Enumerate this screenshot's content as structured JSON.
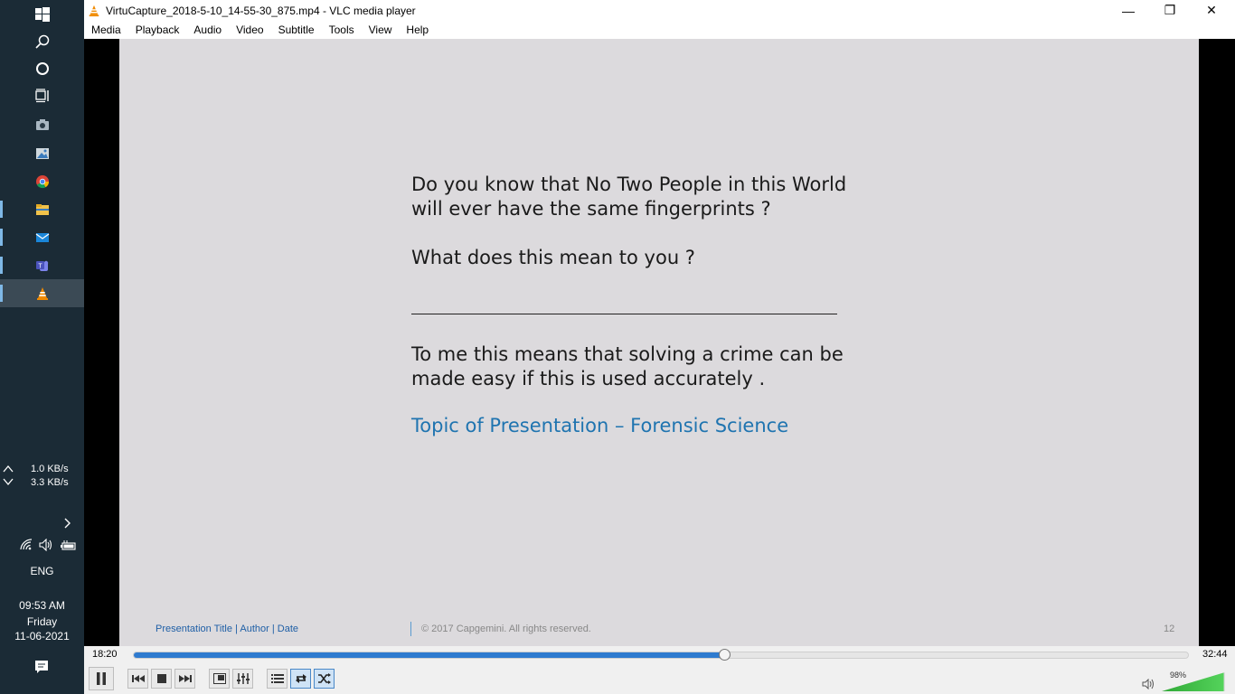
{
  "window": {
    "title": "VirtuCapture_2018-5-10_14-55-30_875.mp4 - VLC media player",
    "minimize": "—",
    "restore": "❐",
    "close": "✕"
  },
  "menu": [
    "Media",
    "Playback",
    "Audio",
    "Video",
    "Subtitle",
    "Tools",
    "View",
    "Help"
  ],
  "slide": {
    "q1": "Do you know that No Two People in this World",
    "q2": "will ever have the same fingerprints ?",
    "q3": "What does this mean to you ?",
    "a1": "To me this means that solving a crime can be",
    "a2": "made easy if this is used accurately .",
    "topic": "Topic of Presentation – Forensic Science",
    "footer_left_title": "Presentation Title",
    "footer_sep1": "|",
    "footer_author": "Author",
    "footer_sep2": "|",
    "footer_date": "Date",
    "footer_copyright": "© 2017 Capgemini. All rights reserved.",
    "page_number": "12"
  },
  "playback": {
    "elapsed": "18:20",
    "total": "32:44",
    "progress_fraction": 0.56
  },
  "volume": {
    "percent_label": "98%",
    "level_fraction": 0.98
  },
  "taskbar": {
    "net_up": "1.0 KB/s",
    "net_down": "3.3 KB/s",
    "language": "ENG",
    "time": "09:53 AM",
    "day": "Friday",
    "date": "11-06-2021"
  },
  "colors": {
    "accent": "#2f7bcf",
    "slide_topic": "#1f74b0",
    "taskbar_bg": "#1b2b36"
  }
}
